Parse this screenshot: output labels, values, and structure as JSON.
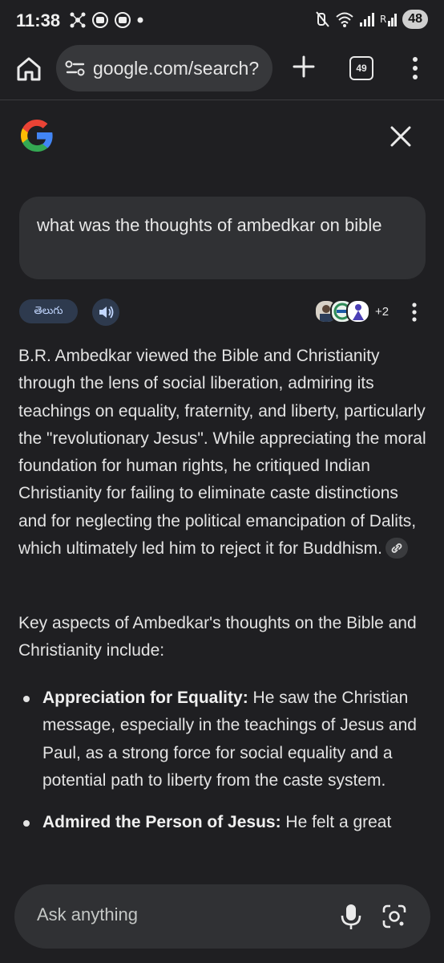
{
  "status_bar": {
    "time": "11:38",
    "battery": "48",
    "icons": [
      "network-hub-icon",
      "notification-icon",
      "notification-icon",
      "dot-icon",
      "mute-icon",
      "wifi-icon",
      "signal-icon",
      "signal-r-icon"
    ]
  },
  "browser": {
    "url": "google.com/search?",
    "tab_count": "49",
    "icons": [
      "home-icon",
      "site-settings-icon",
      "plus-icon",
      "tabs-icon",
      "more-vert-icon"
    ]
  },
  "header": {
    "logo": "google-g-logo",
    "close_icon": "close-icon"
  },
  "query": {
    "text": "what was the thoughts of ambedkar on bible"
  },
  "answer_toolbar": {
    "language_chip": "తెలుగు",
    "sources_more": "+2",
    "icons": [
      "speaker-icon",
      "source-avatar",
      "more-vert-icon"
    ]
  },
  "answer": {
    "summary": "B.R. Ambedkar viewed the Bible and Christianity through the lens of social liberation, admiring its teachings on equality, fraternity, and liberty, particularly the \"revolutionary Jesus\". While appreciating the moral foundation for human rights, he critiqued Indian Christianity for failing to eliminate caste distinctions and for neglecting the political emancipation of Dalits, which ultimately led him to reject it for Buddhism.",
    "intro": "Key aspects of Ambedkar's thoughts on the Bible and Christianity include:",
    "bullets": [
      {
        "title": "Appreciation for Equality:",
        "text": " He saw the Christian message, especially in the teachings of Jesus and Paul, as a strong force for social equality and a potential path to liberty from the caste system."
      },
      {
        "title": "Admired the Person of Jesus:",
        "text": " He felt a great"
      }
    ]
  },
  "ask_bar": {
    "placeholder": "Ask anything",
    "icons": [
      "mic-icon",
      "google-lens-icon"
    ]
  },
  "colors": {
    "background": "#1f1f22",
    "surface": "#303134",
    "chip": "#2e3a4e",
    "text": "#e3e3e3"
  }
}
